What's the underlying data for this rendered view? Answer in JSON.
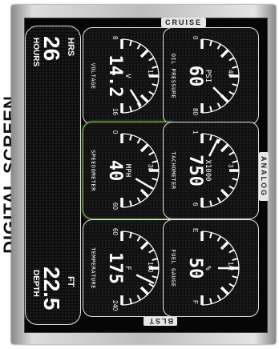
{
  "side_title": "DIGITAL SCREEN",
  "tags": {
    "top": "CRUISE",
    "left": "ANALOG",
    "bottom": "BLST"
  },
  "gauges": [
    {
      "name": "VOLTAGE",
      "unit": "V",
      "value": "14.2",
      "ticks": [
        "8",
        "13",
        "16"
      ],
      "selected": false,
      "level": 0.82
    },
    {
      "name": "OIL PRESSURE",
      "unit": "PSI",
      "value": "60",
      "ticks": [
        "0",
        "40",
        "80"
      ],
      "selected": false,
      "level": 0.75
    },
    {
      "name": "SPEEDOMETER",
      "unit": "MPH",
      "value": "40",
      "ticks": [
        "0",
        "30",
        "60"
      ],
      "selected": true,
      "level": 0.67
    },
    {
      "name": "TACHOMETER",
      "unit": "X1000",
      "value": "750",
      "ticks": [
        "1",
        "3",
        "6"
      ],
      "selected": false,
      "level": 0.15
    },
    {
      "name": "TEMPERATURE",
      "unit": "F",
      "value": "175",
      "ticks": [
        "60",
        "160",
        "240"
      ],
      "selected": false,
      "level": 0.64
    },
    {
      "name": "FUEL GAUGE",
      "unit": "%",
      "value": "50",
      "ticks": [
        "E",
        "1/2",
        "F"
      ],
      "selected": false,
      "level": 0.5
    }
  ],
  "hours": {
    "label": "HRS",
    "value": "26",
    "caption": "HOURS"
  },
  "depth": {
    "label": "FT",
    "value": "22.5",
    "caption": "DEPTH"
  }
}
